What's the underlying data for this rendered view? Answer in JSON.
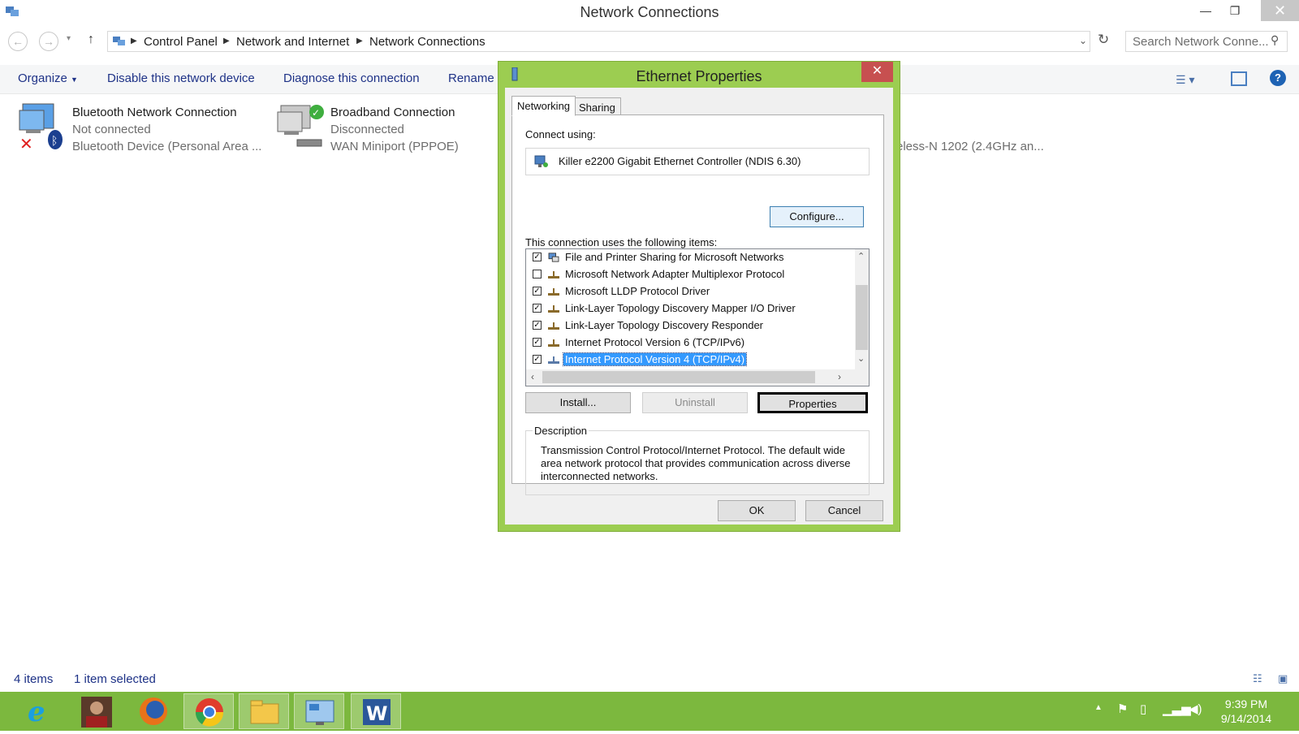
{
  "window": {
    "title": "Network Connections",
    "min": "—",
    "max": "❐",
    "close": "✕"
  },
  "address": {
    "crumbs": [
      "Control Panel",
      "Network and Internet",
      "Network Connections"
    ],
    "search_placeholder": "Search Network Conne..."
  },
  "command_bar": {
    "organize": "Organize",
    "disable": "Disable this network device",
    "diagnose": "Diagnose this connection",
    "rename": "Rename t"
  },
  "connections": [
    {
      "name": "Bluetooth Network Connection",
      "status": "Not connected",
      "device": "Bluetooth Device (Personal Area ..."
    },
    {
      "name": "Broadband Connection",
      "status": "Disconnected",
      "device": "WAN Miniport (PPPOE)"
    },
    {
      "name": "",
      "status": "",
      "device": "eless-N 1202 (2.4GHz an..."
    }
  ],
  "status_bar": {
    "count": "4 items",
    "selected": "1 item selected"
  },
  "dialog": {
    "title": "Ethernet Properties",
    "close": "✕",
    "tabs": [
      "Networking",
      "Sharing"
    ],
    "connect_using_label": "Connect using:",
    "adapter": "Killer e2200 Gigabit Ethernet Controller (NDIS 6.30)",
    "configure": "Configure...",
    "items_label": "This connection uses the following items:",
    "items": [
      {
        "label": "File and Printer Sharing for Microsoft Networks",
        "checked": "✓"
      },
      {
        "label": "Microsoft Network Adapter Multiplexor Protocol",
        "checked": ""
      },
      {
        "label": "Microsoft LLDP Protocol Driver",
        "checked": "✓"
      },
      {
        "label": "Link-Layer Topology Discovery Mapper I/O Driver",
        "checked": "✓"
      },
      {
        "label": "Link-Layer Topology Discovery Responder",
        "checked": "✓"
      },
      {
        "label": "Internet Protocol Version 6 (TCP/IPv6)",
        "checked": "✓"
      },
      {
        "label": "Internet Protocol Version 4 (TCP/IPv4)",
        "checked": "✓"
      }
    ],
    "install": "Install...",
    "uninstall": "Uninstall",
    "properties": "Properties",
    "description_label": "Description",
    "description": "Transmission Control Protocol/Internet Protocol. The default wide area network protocol that provides communication across diverse interconnected networks.",
    "ok": "OK",
    "cancel": "Cancel"
  },
  "taskbar": {
    "time": "9:39 PM",
    "date": "9/14/2014"
  },
  "colors": {
    "accent": "#9ccd51",
    "taskbar": "#7cb83e",
    "selection": "#3399ff",
    "close_red": "#c75050"
  }
}
